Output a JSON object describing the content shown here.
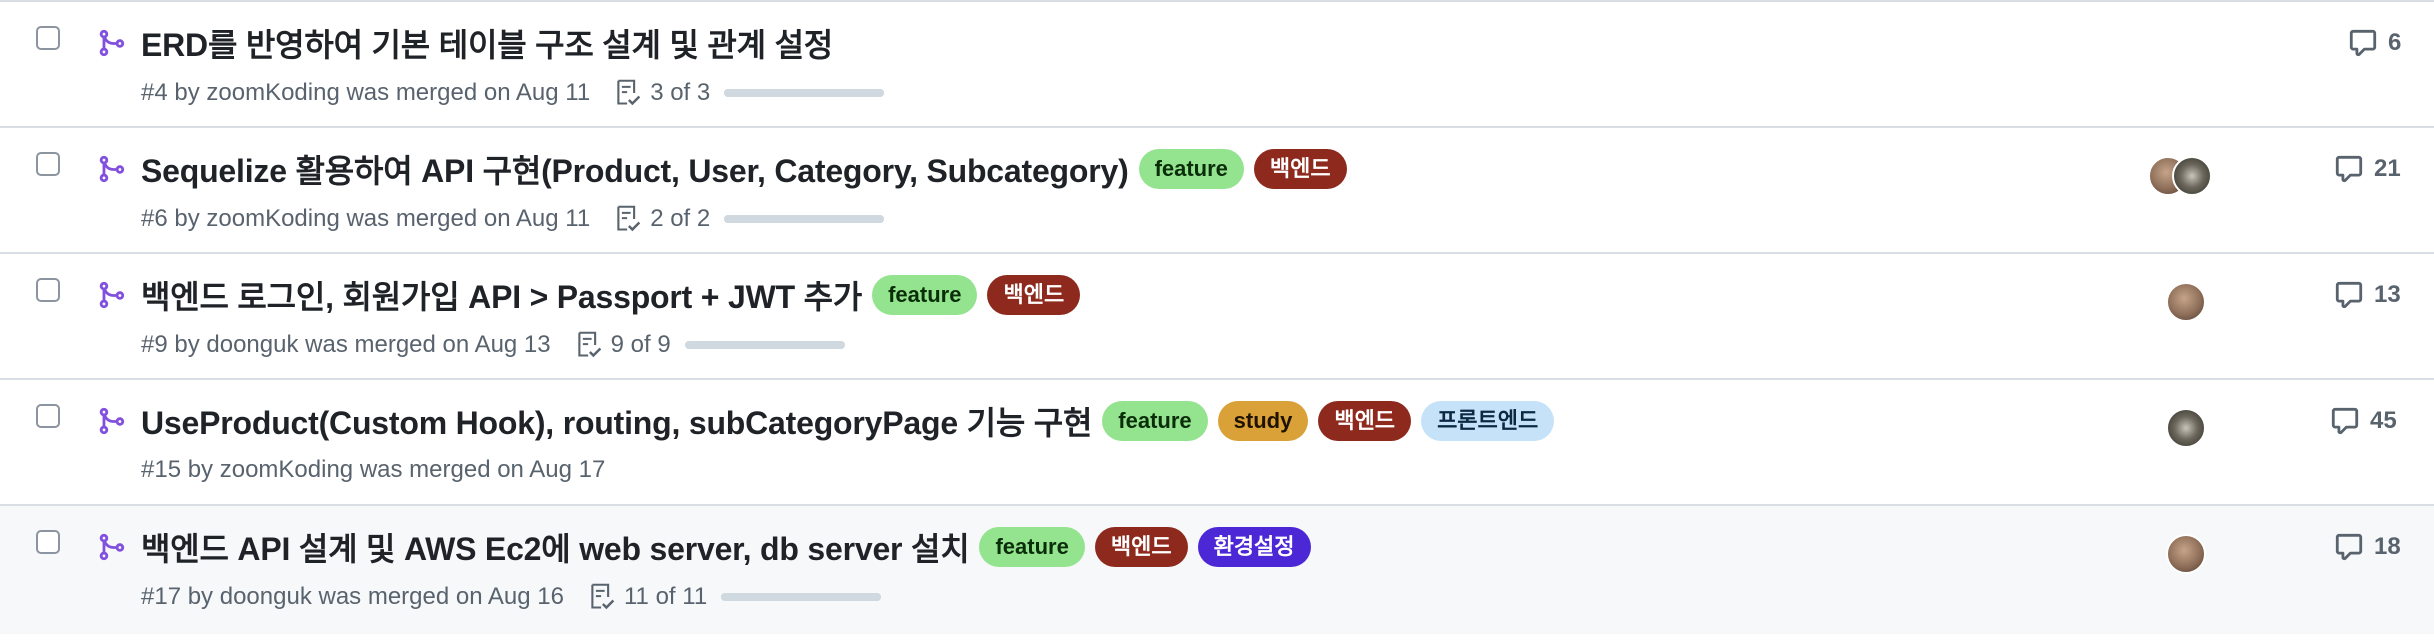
{
  "colors": {
    "merged": "#8250df",
    "feature_bg": "#94e38f",
    "feature_fg": "#0b2e0a",
    "backend_bg": "#8e2a1d",
    "backend_fg": "#ffffff",
    "study_bg": "#d9a137",
    "study_fg": "#1f1300",
    "frontend_bg": "#c6e2f8",
    "frontend_fg": "#0a2a44",
    "env_bg": "#4b27d6",
    "env_fg": "#ffffff"
  },
  "pulls": [
    {
      "title": "ERD를 반영하여 기본 테이블 구조 설계 및 관계 설정",
      "labels": [],
      "meta": "#4 by zoomKoding was merged on Aug 11",
      "tasks": "3 of 3",
      "tasks_done_ratio": 1.0,
      "avatars": [],
      "comments": "6"
    },
    {
      "title": "Sequelize 활용하여 API 구현(Product, User, Category, Subcategory)",
      "labels": [
        "feature",
        "백엔드"
      ],
      "meta": "#6 by zoomKoding was merged on Aug 11",
      "tasks": "2 of 2",
      "tasks_done_ratio": 1.0,
      "avatars": [
        "avatar",
        "avatar"
      ],
      "comments": "21"
    },
    {
      "title": "백엔드 로그인, 회원가입 API > Passport + JWT 추가",
      "labels": [
        "feature",
        "백엔드"
      ],
      "meta": "#9 by doonguk was merged on Aug 13",
      "tasks": "9 of 9",
      "tasks_done_ratio": 1.0,
      "avatars": [
        "avatar"
      ],
      "comments": "13"
    },
    {
      "title": "UseProduct(Custom Hook), routing, subCategoryPage 기능 구현",
      "labels": [
        "feature",
        "study",
        "백엔드",
        "프론트엔드"
      ],
      "meta": "#15 by zoomKoding was merged on Aug 17",
      "tasks": null,
      "tasks_done_ratio": null,
      "avatars": [
        "avatar"
      ],
      "comments": "45"
    },
    {
      "title": "백엔드 API 설계 및 AWS Ec2에 web server, db server 설치",
      "labels": [
        "feature",
        "백엔드",
        "환경설정"
      ],
      "meta": "#17 by doonguk was merged on Aug 16",
      "tasks": "11 of 11",
      "tasks_done_ratio": 1.0,
      "avatars": [
        "avatar"
      ],
      "comments": "18"
    }
  ]
}
